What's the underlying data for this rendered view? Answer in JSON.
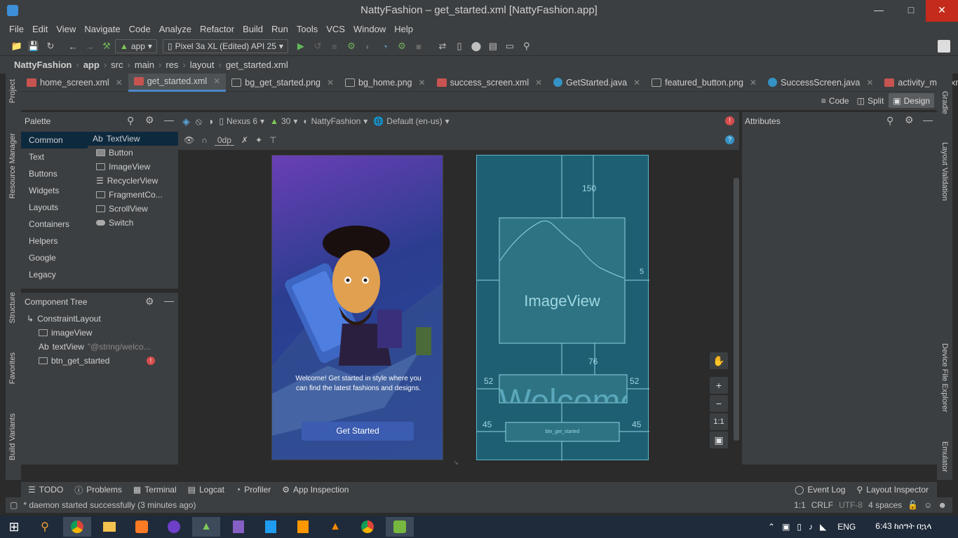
{
  "window": {
    "title": "NattyFashion – get_started.xml [NattyFashion.app]"
  },
  "menu": [
    "File",
    "Edit",
    "View",
    "Navigate",
    "Code",
    "Analyze",
    "Refactor",
    "Build",
    "Run",
    "Tools",
    "VCS",
    "Window",
    "Help"
  ],
  "toolbar": {
    "run_config": "app",
    "device": "Pixel 3a XL (Edited) API 25"
  },
  "breadcrumb": [
    "NattyFashion",
    "app",
    "src",
    "main",
    "res",
    "layout",
    "get_started.xml"
  ],
  "tabs": [
    {
      "label": "home_screen.xml",
      "color": "#c75450"
    },
    {
      "label": "get_started.xml",
      "color": "#c75450"
    },
    {
      "label": "bg_get_started.png",
      "color": "#6a9fb5"
    },
    {
      "label": "bg_home.png",
      "color": "#6a9fb5"
    },
    {
      "label": "success_screen.xml",
      "color": "#c75450"
    },
    {
      "label": "GetStarted.java",
      "color": "#3592c4"
    },
    {
      "label": "featured_button.png",
      "color": "#6a9fb5"
    },
    {
      "label": "SuccessScreen.java",
      "color": "#3592c4"
    },
    {
      "label": "activity_main.xml",
      "color": "#c75450"
    }
  ],
  "view_modes": {
    "code": "Code",
    "split": "Split",
    "design": "Design"
  },
  "left_strip": {
    "project": "Project",
    "resource_manager": "Resource Manager",
    "structure": "Structure",
    "favorites": "Favorites",
    "build_variants": "Build Variants"
  },
  "right_strip": {
    "gradle": "Gradle",
    "layout_validation": "Layout Validation",
    "device_file_explorer": "Device File Explorer",
    "emulator": "Emulator"
  },
  "palette": {
    "title": "Palette",
    "categories": [
      "Common",
      "Text",
      "Buttons",
      "Widgets",
      "Layouts",
      "Containers",
      "Helpers",
      "Google",
      "Legacy"
    ],
    "widgets": [
      "TextView",
      "Button",
      "ImageView",
      "RecyclerView",
      "FragmentCo...",
      "ScrollView",
      "Switch"
    ],
    "textview_prefix": "Ab"
  },
  "component_tree": {
    "title": "Component Tree",
    "root": "ConstraintLayout",
    "items": [
      {
        "name": "imageView",
        "extra": ""
      },
      {
        "name": "textView",
        "extra": "\"@string/welco..."
      },
      {
        "name": "btn_get_started",
        "extra": ""
      }
    ]
  },
  "design_toolbar": {
    "device": "Nexus 6",
    "api": "30",
    "theme": "NattyFashion",
    "locale": "Default (en-us)",
    "margin": "0dp"
  },
  "attributes": {
    "title": "Attributes"
  },
  "preview": {
    "welcome": "Welcome! Get started in style where you can find the latest fashions and designs.",
    "button": "Get Started"
  },
  "blueprint": {
    "top_margin": "150",
    "right_margin": "5",
    "image_label": "ImageView",
    "gap": "76",
    "text_left": "52",
    "text_right": "52",
    "text_label": "Welcome",
    "btn_left": "45",
    "btn_right": "45",
    "btn_label": "btn_get_started"
  },
  "zoom": {
    "one_to_one": "1:1"
  },
  "bottom_tools": [
    "TODO",
    "Problems",
    "Terminal",
    "Logcat",
    "Profiler",
    "App Inspection"
  ],
  "bottom_right_tools": [
    "Event Log",
    "Layout Inspector"
  ],
  "status": {
    "message": "* daemon started successfully (3 minutes ago)",
    "position": "1:1",
    "line_sep": "CRLF",
    "encoding": "UTF-8",
    "indent": "4 spaces"
  },
  "taskbar": {
    "lang": "ENG",
    "time": "6:43 ከሰዓት በኋላ"
  }
}
